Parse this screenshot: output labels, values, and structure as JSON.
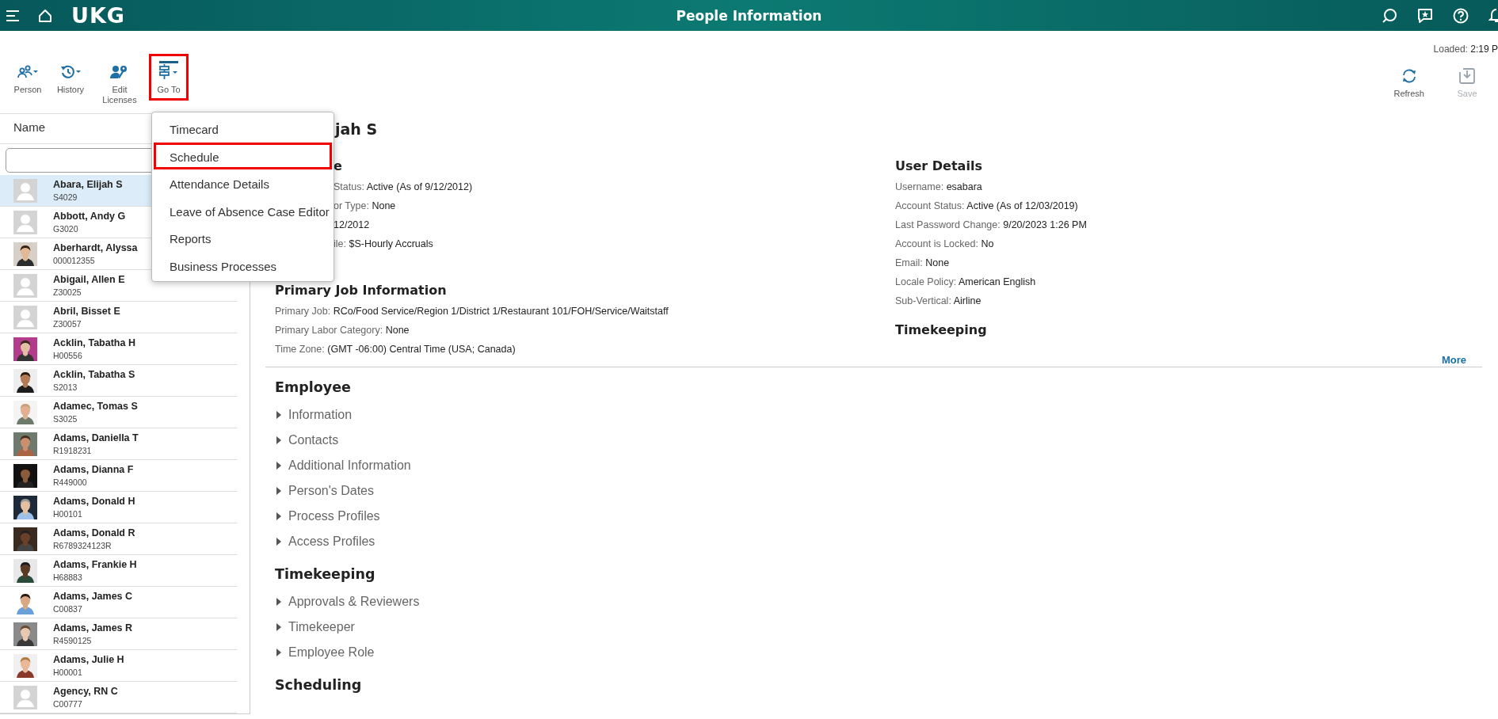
{
  "header": {
    "logo": "UKG",
    "title": "People Information"
  },
  "loaded": {
    "label": "Loaded:",
    "value": "2:19 P"
  },
  "toolbar": [
    {
      "label": "Person",
      "kind": "person",
      "selected": false,
      "highlighted": false
    },
    {
      "label": "History",
      "kind": "history",
      "selected": false,
      "highlighted": false
    },
    {
      "label": "Edit Licenses",
      "kind": "licenses",
      "selected": false,
      "highlighted": false
    },
    {
      "label": "Go To",
      "kind": "goto",
      "selected": true,
      "highlighted": true
    }
  ],
  "actions": [
    {
      "label": "Refresh",
      "kind": "refresh",
      "disabled": false
    },
    {
      "label": "Save",
      "kind": "save",
      "disabled": true
    }
  ],
  "people_list": {
    "column": "Name",
    "rows": [
      {
        "name": "Abara, Elijah S",
        "id": "S4029",
        "kind": "placeholder",
        "selected": true
      },
      {
        "name": "Abbott, Andy G",
        "id": "G3020",
        "kind": "placeholder",
        "selected": false
      },
      {
        "name": "Aberhardt, Alyssa",
        "id": "000012355",
        "selected": false
      },
      {
        "name": "Abigail, Allen E",
        "id": "Z30025",
        "kind": "placeholder",
        "selected": false
      },
      {
        "name": "Abril, Bisset E",
        "id": "Z30057",
        "kind": "placeholder",
        "selected": false
      },
      {
        "name": "Acklin, Tabatha H",
        "id": "H00556",
        "selected": false
      },
      {
        "name": "Acklin, Tabatha S",
        "id": "S2013",
        "selected": false
      },
      {
        "name": "Adamec, Tomas S",
        "id": "S3025",
        "selected": false
      },
      {
        "name": "Adams, Daniella T",
        "id": "R1918231",
        "selected": false
      },
      {
        "name": "Adams, Dianna F",
        "id": "R449000",
        "selected": false
      },
      {
        "name": "Adams, Donald H",
        "id": "H00101",
        "selected": false
      },
      {
        "name": "Adams, Donald R",
        "id": "R6789324123R",
        "selected": false
      },
      {
        "name": "Adams, Frankie H",
        "id": "H68883",
        "selected": false
      },
      {
        "name": "Adams, James C",
        "id": "C00837",
        "selected": false
      },
      {
        "name": "Adams, James R",
        "id": "R4590125",
        "selected": false
      },
      {
        "name": "Adams, Julie H",
        "id": "H00001",
        "selected": false
      },
      {
        "name": "Agency, RN C",
        "id": "C00777",
        "kind": "placeholder",
        "selected": false
      }
    ]
  },
  "goto_menu": [
    {
      "label": "Timecard",
      "highlighted": false
    },
    {
      "label": "Schedule",
      "highlighted": true
    },
    {
      "label": "Attendance Details",
      "highlighted": false
    },
    {
      "label": "Leave of Absence Case Editor",
      "highlighted": false
    },
    {
      "label": "Reports",
      "highlighted": false
    },
    {
      "label": "Business Processes",
      "highlighted": false
    }
  ],
  "profile": {
    "heading": "jah S",
    "summary": {
      "heading": "e",
      "fields": [
        {
          "label": "Status:",
          "value": "Active (As of 9/12/2012)"
        },
        {
          "label": "or Type:",
          "value": "None"
        },
        {
          "value": "12/2012"
        },
        {
          "label": "ile:",
          "value": "$S-Hourly Accruals"
        }
      ]
    },
    "primary_job": {
      "heading": "Primary Job Information",
      "fields": [
        {
          "label": "Primary Job:",
          "value": "RCo/Food Service/Region 1/District 1/Restaurant 101/FOH/Service/Waitstaff"
        },
        {
          "label": "Primary Labor Category:",
          "value": "None"
        },
        {
          "label": "Time Zone:",
          "value": "(GMT -06:00) Central Time (USA; Canada)"
        }
      ]
    },
    "user_details": {
      "heading": "User Details",
      "fields": [
        {
          "label": "Username:",
          "value": "esabara"
        },
        {
          "label": "Account Status:",
          "value": "Active (As of 12/03/2019)"
        },
        {
          "label": "Last Password Change:",
          "value": "9/20/2023 1:26 PM"
        },
        {
          "label": "Account is Locked:",
          "value": "No"
        },
        {
          "label": "Email:",
          "value": "None"
        },
        {
          "label": "Locale Policy:",
          "value": "American English"
        },
        {
          "label": "Sub-Vertical:",
          "value": "Airline"
        }
      ]
    },
    "timekeeping_heading": "Timekeeping",
    "more_link": "More"
  },
  "groups": [
    {
      "heading": "Employee",
      "items": [
        {
          "label": "Information",
          "expanded": false
        },
        {
          "label": "Contacts",
          "expanded": false
        },
        {
          "label": "Additional Information",
          "expanded": false
        },
        {
          "label": "Person's Dates",
          "expanded": false
        },
        {
          "label": "Process Profiles",
          "expanded": false
        },
        {
          "label": "Access Profiles",
          "expanded": false
        }
      ]
    },
    {
      "heading": "Timekeeping",
      "items": [
        {
          "label": "Approvals & Reviewers",
          "expanded": false
        },
        {
          "label": "Timekeeper",
          "expanded": false
        },
        {
          "label": "Employee Role",
          "expanded": false
        }
      ]
    },
    {
      "heading": "Scheduling"
    }
  ]
}
